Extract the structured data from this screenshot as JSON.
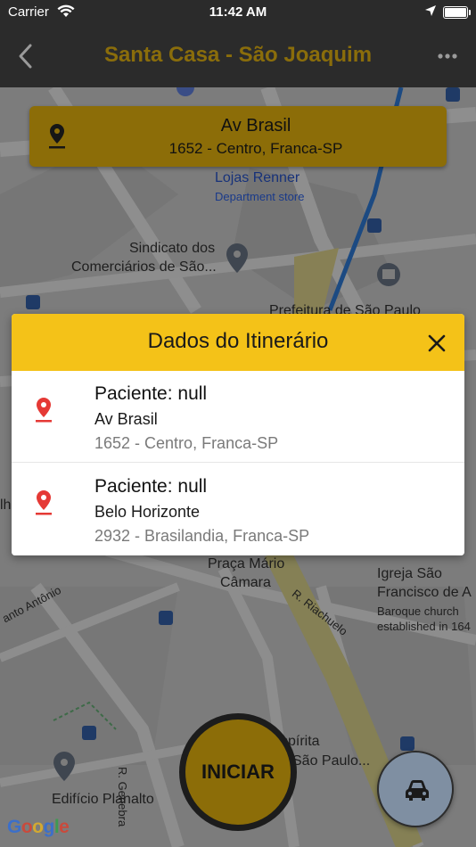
{
  "status_bar": {
    "carrier": "Carrier",
    "time": "11:42 AM"
  },
  "nav_bar": {
    "title": "Santa Casa - São Joaquim"
  },
  "address_card": {
    "street": "Av Brasil",
    "detail": "1652 - Centro, Franca-SP"
  },
  "map_labels": {
    "lojas": "Lojas Renner",
    "lojas_type": "Department store",
    "sindicato_line1": "Sindicato dos",
    "sindicato_line2": "Comerciários de São...",
    "prefeitura": "Prefeitura de São Paulo",
    "praca_line1": "Praça Mário",
    "praca_line2": "Câmara",
    "riachuelo": "R. Riachuelo",
    "antonio": "anto Antônio",
    "igreja_line1": "Igreja São",
    "igreja_line2": "Francisco de A",
    "igreja_type_line1": "Baroque church",
    "igreja_type_line2": "established in 164",
    "genebra": "R. Genebra",
    "espirita_line1": "spírita",
    "espirita_line2": "São Paulo...",
    "planalto": "Edifício Planalto",
    "left_edge": "lh"
  },
  "modal": {
    "title": "Dados do Itinerário",
    "items": [
      {
        "patient": "Paciente: null",
        "street": "Av Brasil",
        "detail": "1652 - Centro, Franca-SP"
      },
      {
        "patient": "Paciente: null",
        "street": "Belo Horizonte",
        "detail": "2932 - Brasilandia, Franca-SP"
      }
    ]
  },
  "start_button": {
    "label": "INICIAR"
  },
  "google_logo": {
    "g1": "G",
    "o1": "o",
    "o2": "o",
    "g2": "g",
    "l": "l",
    "e": "e"
  },
  "colors": {
    "accent": "#f4c218",
    "accent_dimmed": "#8c6d08",
    "pin": "#e53935",
    "nav_bg": "#2b2b2b"
  }
}
